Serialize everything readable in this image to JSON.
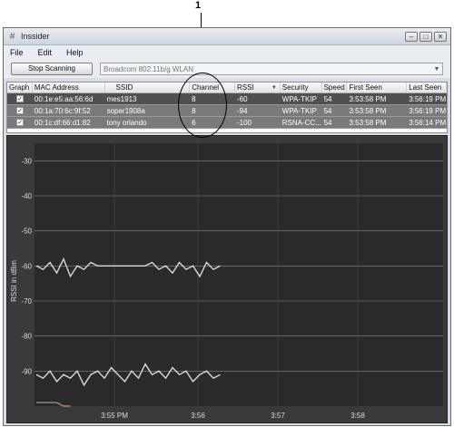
{
  "callout": {
    "number": "1"
  },
  "window": {
    "title": "Inssider",
    "controls": [
      "–",
      "□",
      "✕"
    ]
  },
  "menu": {
    "items": [
      "File",
      "Edit",
      "Help"
    ]
  },
  "toolbar": {
    "scan_button": "Stop Scanning",
    "adapter": "Broadcom 802.11b/g WLAN",
    "dropdown_arrow": "▼"
  },
  "table": {
    "columns": [
      "Graph",
      "MAC Address",
      "SSID",
      "Channel",
      "RSSI",
      "Security",
      "Speed",
      "First Seen",
      "Last Seen"
    ],
    "sort_indicator": "▼",
    "rows": [
      {
        "graph": "✓",
        "mac": "00:1e:e5:aa:56:6d",
        "ssid": "mes1913",
        "channel": "8",
        "rssi": "-60",
        "security": "WPA-TKIP",
        "speed": "54",
        "first_seen": "3:53:58 PM",
        "last_seen": "3:56:19 PM"
      },
      {
        "graph": "✓",
        "mac": "00:1a:70:6c:9f:52",
        "ssid": "soper1908a",
        "channel": "8",
        "rssi": "-94",
        "security": "WPA-TKIP",
        "speed": "54",
        "first_seen": "3:53:58 PM",
        "last_seen": "3:56:19 PM"
      },
      {
        "graph": "✓",
        "mac": "00:1c:df:66:d1:82",
        "ssid": "tony orlando",
        "channel": "6",
        "rssi": "-100",
        "security": "RSNA-CC...",
        "speed": "54",
        "first_seen": "3:53:58 PM",
        "last_seen": "3:56:14 PM"
      }
    ]
  },
  "graph": {
    "y_axis_label": "RSSI in dBm",
    "y_ticks": [
      "-30",
      "-40",
      "-50",
      "-60",
      "-70",
      "-80",
      "-90"
    ],
    "x_ticks": [
      "3:55 PM",
      "3:56",
      "3:57",
      "3:58"
    ],
    "colors": {
      "background": "#2a2a2a",
      "grid": "#8a8a8a",
      "series": "#d8d8d8",
      "series3": "#a08a80"
    }
  },
  "chart_data": {
    "type": "line",
    "ylabel": "RSSI in dBm",
    "ylim": [
      -100,
      -25
    ],
    "x_ticks": [
      "3:55 PM",
      "3:56",
      "3:57",
      "3:58"
    ],
    "series": [
      {
        "values": [
          -60,
          -61,
          -59,
          -62,
          -58,
          -63,
          -60,
          -61,
          -59,
          -60,
          -60,
          -60,
          -60,
          -60,
          -60,
          -60,
          -60,
          -59,
          -61,
          -60,
          -62,
          -59,
          -61,
          -60,
          -63,
          -59,
          -61,
          -60
        ]
      },
      {
        "values": [
          -91,
          -92,
          -90,
          -93,
          -91,
          -92,
          -90,
          -94,
          -91,
          -90,
          -92,
          -89,
          -91,
          -93,
          -90,
          -92,
          -88,
          -91,
          -90,
          -92,
          -89,
          -91,
          -90,
          -93,
          -91,
          -90,
          -92,
          -91
        ]
      },
      {
        "values": [
          -99,
          -99,
          -99,
          -99,
          -100,
          -100
        ]
      }
    ]
  }
}
